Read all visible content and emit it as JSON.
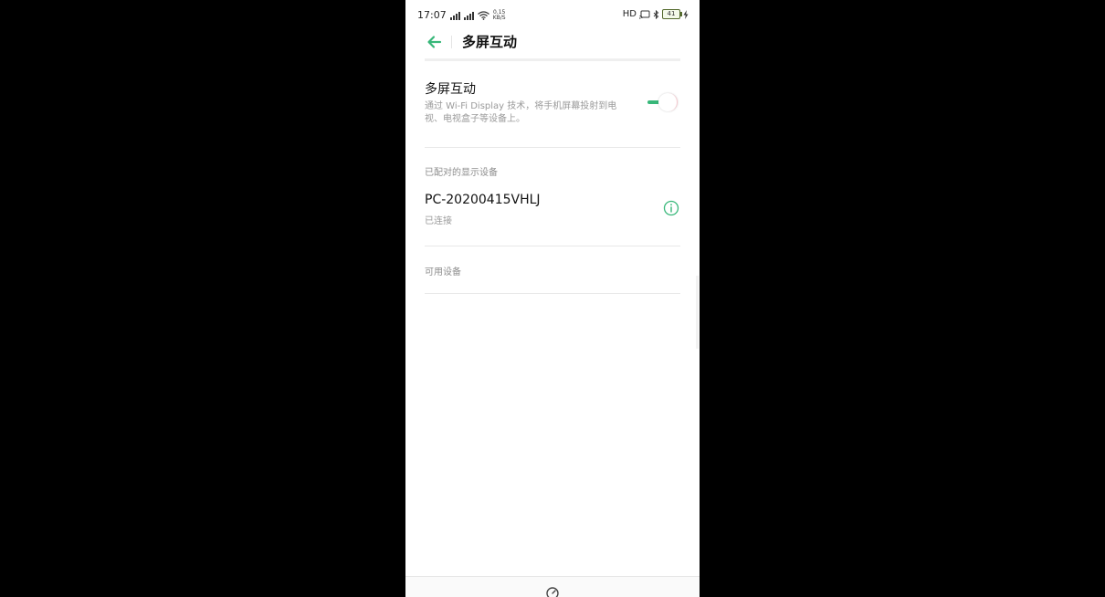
{
  "status_bar": {
    "time": "17:07",
    "net_speed_value": "0.15",
    "net_speed_unit": "KB/S",
    "hd_label": "HD",
    "battery_level": "41"
  },
  "app_bar": {
    "title": "多屏互动"
  },
  "feature": {
    "title": "多屏互动",
    "description": "通过 Wi-Fi Display 技术，将手机屏幕投射到电视、电视盒子等设备上。",
    "enabled": true
  },
  "paired_section": {
    "header": "已配对的显示设备",
    "devices": [
      {
        "name": "PC-20200415VHLJ",
        "status": "已连接"
      }
    ]
  },
  "available_section": {
    "header": "可用设备"
  },
  "colors": {
    "accent": "#37b779",
    "text_primary": "#111111",
    "text_secondary": "#9a9a9a"
  },
  "icons": {
    "back": "arrow-left-icon",
    "info": "info-circle-icon",
    "nav": "speedometer-icon"
  }
}
